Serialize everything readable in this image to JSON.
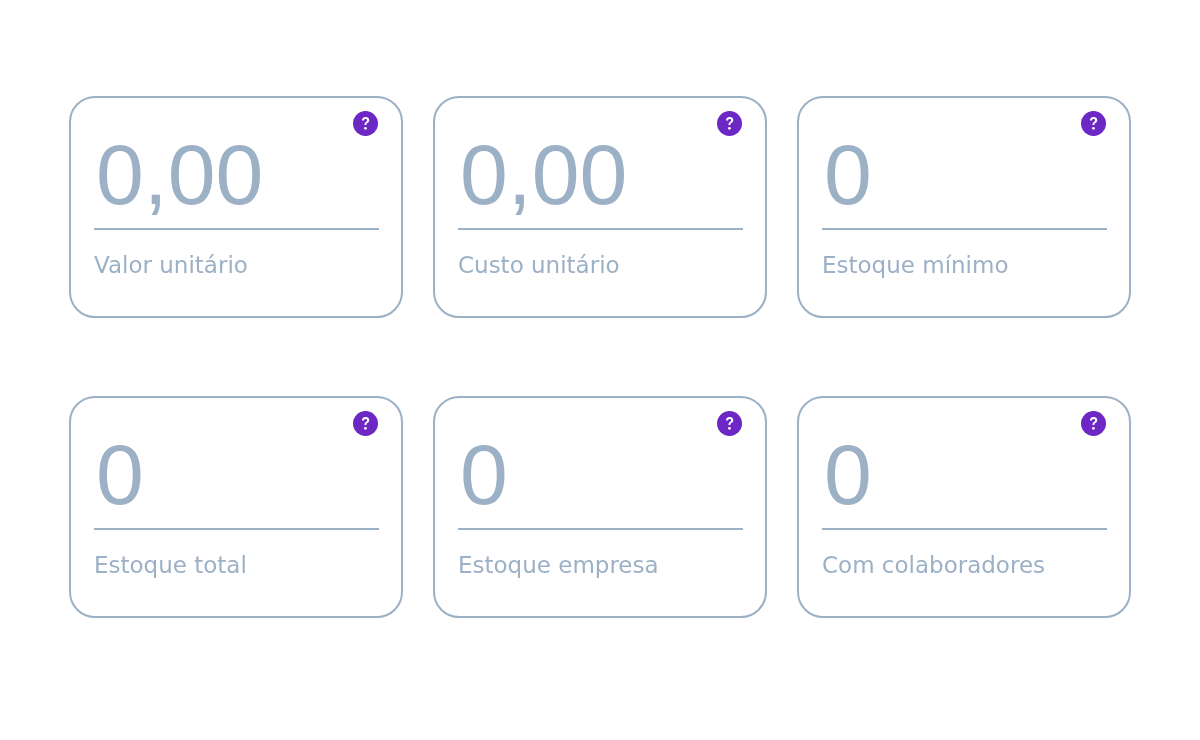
{
  "cards": [
    {
      "value": "0,00",
      "label": "Valor unitário"
    },
    {
      "value": "0,00",
      "label": "Custo unitário"
    },
    {
      "value": "0",
      "label": "Estoque mínimo"
    },
    {
      "value": "0",
      "label": "Estoque total"
    },
    {
      "value": "0",
      "label": "Estoque empresa"
    },
    {
      "value": "0",
      "label": "Com colaboradores"
    }
  ]
}
